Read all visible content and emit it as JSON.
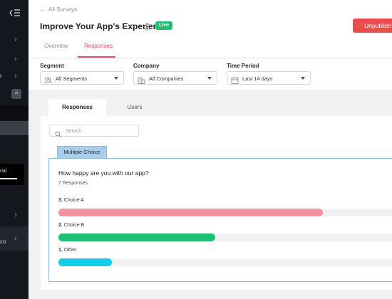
{
  "sidebar": {
    "trial_text": "rial",
    "item_cut_1": "r",
    "item_cut_2": "co"
  },
  "header": {
    "back_label": "All Surveys",
    "title": "Improve Your App's Experience",
    "status_badge": "Live",
    "publish_label": "Unpublish",
    "tabs": [
      {
        "label": "Overview",
        "active": false
      },
      {
        "label": "Responses",
        "active": true
      }
    ]
  },
  "filters": {
    "segment": {
      "label": "Segment",
      "value": "All Segments",
      "icon": "users-icon"
    },
    "company": {
      "label": "Company",
      "value": "All Companies",
      "icon": "building-icon"
    },
    "time_period": {
      "label": "Time Period",
      "value": "Last 14 days",
      "icon": "calendar-icon"
    }
  },
  "content": {
    "subtabs": [
      {
        "label": "Responses",
        "active": true
      },
      {
        "label": "Users",
        "active": false
      }
    ],
    "search": {
      "placeholder": "Search..."
    },
    "question_type": "Multiple Choice",
    "question": {
      "title": "How happy are you with our app?",
      "responses": "7 Responses",
      "choices": [
        {
          "rank": "3.",
          "label": "Choice A",
          "fraction": 0.79,
          "color": "#f5909f"
        },
        {
          "rank": "2.",
          "label": "Choice B",
          "fraction": 0.47,
          "color": "#1dbf73"
        },
        {
          "rank": "1.",
          "label": "Other",
          "fraction": 0.16,
          "color": "#12cdec"
        }
      ]
    }
  },
  "colors": {
    "accent": "#e24a6b",
    "publish": "#ea4e4c",
    "live": "#1dbf73",
    "sidebar": "#14171e"
  }
}
